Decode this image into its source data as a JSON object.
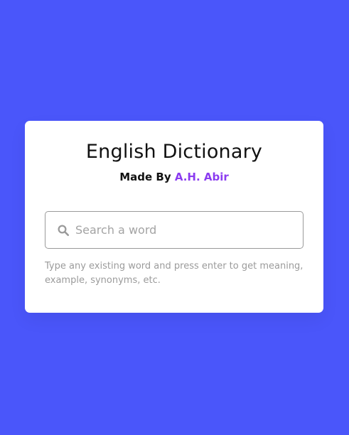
{
  "app": {
    "title": "English Dictionary",
    "made_by_prefix": "Made By ",
    "author": "A.H. Abir"
  },
  "search": {
    "placeholder": "Search a word",
    "value": "",
    "icon": "search-icon"
  },
  "hint": {
    "text": "Type any existing word and press enter to get meaning, example, synonyms, etc."
  },
  "colors": {
    "background": "#4a56fa",
    "card": "#ffffff",
    "author_accent": "#8b3cf0",
    "hint_text": "#9b9b9b"
  }
}
